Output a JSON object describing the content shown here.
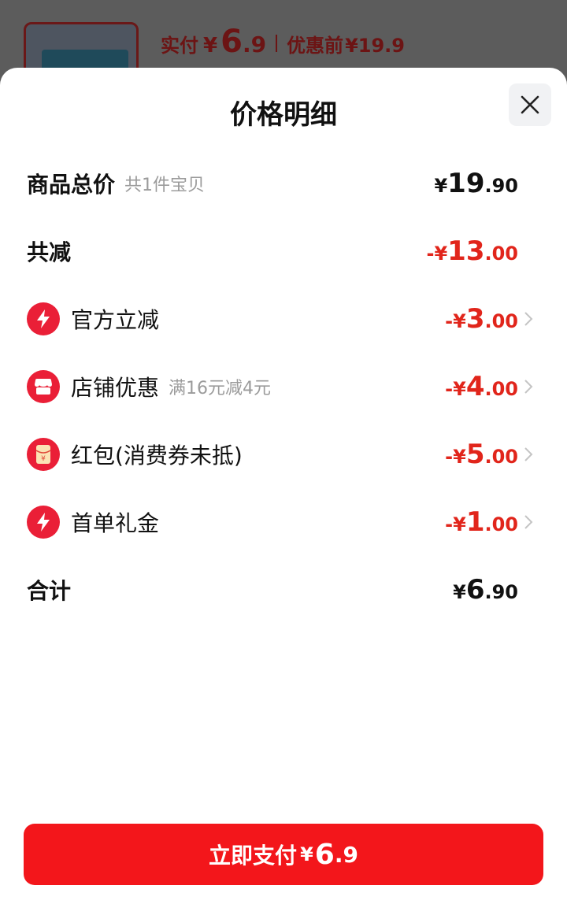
{
  "background": {
    "price_label": "实付",
    "currency": "¥",
    "price_int": "6",
    "price_dec": ".9",
    "original_label": "优惠前",
    "original_price": "¥19.9"
  },
  "sheet": {
    "title": "价格明细",
    "close_icon": "close-icon"
  },
  "rows": {
    "total": {
      "label": "商品总价",
      "sub": "共1件宝贝",
      "currency": "¥",
      "int": "19",
      "dec": ".90"
    },
    "discount_total": {
      "label": "共减",
      "currency": "-¥",
      "int": "13",
      "dec": ".00"
    },
    "official": {
      "label": "官方立减",
      "icon": "lightning-icon",
      "currency": "-¥",
      "int": "3",
      "dec": ".00"
    },
    "store": {
      "label": "店铺优惠",
      "sub": "满16元减4元",
      "icon": "store-icon",
      "currency": "-¥",
      "int": "4",
      "dec": ".00"
    },
    "redpacket": {
      "label": "红包(消费券未抵)",
      "icon": "red-envelope-icon",
      "currency": "-¥",
      "int": "5",
      "dec": ".00"
    },
    "first_order": {
      "label": "首单礼金",
      "icon": "lightning-icon",
      "currency": "-¥",
      "int": "1",
      "dec": ".00"
    },
    "sum": {
      "label": "合计",
      "currency": "¥",
      "int": "6",
      "dec": ".90"
    }
  },
  "pay_button": {
    "label": "立即支付",
    "currency": "¥",
    "int": "6",
    "dec": ".9"
  },
  "colors": {
    "accent_red": "#e1251b",
    "button_red": "#f3161b"
  }
}
